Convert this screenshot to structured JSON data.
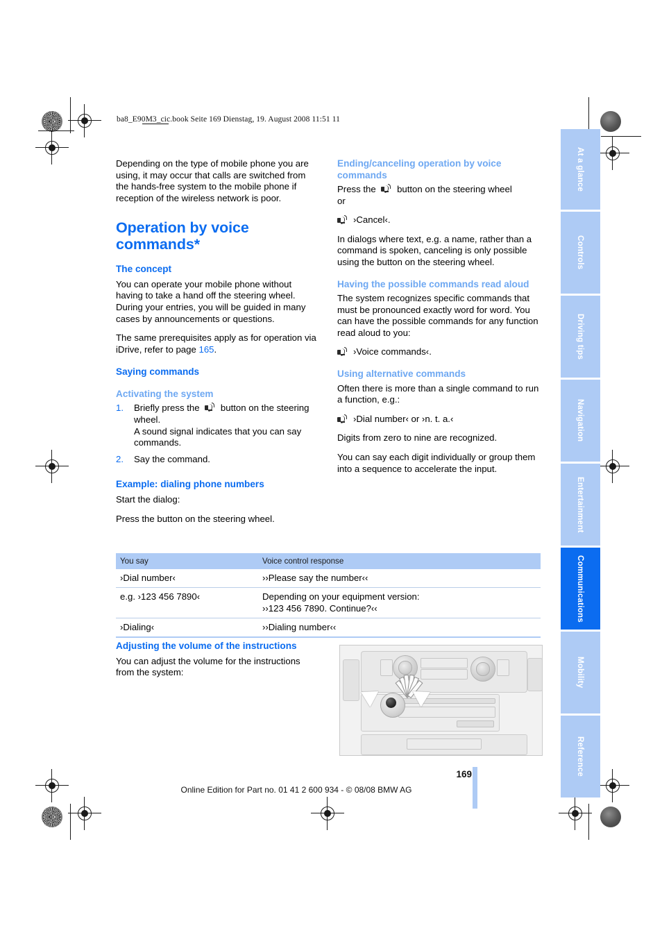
{
  "header": {
    "file_info": "ba8_E90M3_cic.book  Seite 169  Dienstag, 19. August 2008  11:51 11"
  },
  "left_column": {
    "intro_paragraph": "Depending on the type of mobile phone you are using, it may occur that calls are switched from the hands-free system to the mobile phone if reception of the wireless network is poor.",
    "title": "Operation by voice commands*",
    "concept_heading": "The concept",
    "concept_p1": "You can operate your mobile phone without having to take a hand off the steering wheel. During your entries, you will be guided in many cases by announcements or questions.",
    "concept_p2_before": "The same prerequisites apply as for operation via iDrive, refer to page ",
    "concept_p2_ref": "165",
    "concept_p2_after": ".",
    "saying_heading": "Saying commands",
    "activating_heading": "Activating the system",
    "step1_num": "1.",
    "step1_before": "Briefly press the",
    "step1_after": "button on the steering wheel.",
    "step1_note": "A sound signal indicates that you can say commands.",
    "step2_num": "2.",
    "step2_text": "Say the command.",
    "example_heading": "Example: dialing phone numbers",
    "example_p1": "Start the dialog:",
    "example_p2": "Press the button on the steering wheel.",
    "volume_heading": "Adjusting the volume of the instructions",
    "volume_p1": "You can adjust the volume for the instructions from the system:"
  },
  "table": {
    "columns": [
      "You say",
      "Voice control response"
    ],
    "rows": [
      {
        "you_say": "›Dial number‹",
        "response": "››Please say the number‹‹",
        "response2": ""
      },
      {
        "you_say": "e.g. ›123 456 7890‹",
        "response": "Depending on your equipment version:",
        "response2": "››123 456 7890. Continue?‹‹"
      },
      {
        "you_say": "›Dialing‹",
        "response": "››Dialing number‹‹",
        "response2": ""
      }
    ]
  },
  "right_column": {
    "ending_heading": "Ending/canceling operation by voice commands",
    "ending_p1_before": "Press the",
    "ending_p1_after": "button on the steering wheel",
    "ending_or": "or",
    "ending_cmd": "›Cancel‹.",
    "ending_p2": "In dialogs where text, e.g. a name, rather than a command is spoken, canceling is only possible using the button on the steering wheel.",
    "readaloud_heading": "Having the possible commands read aloud",
    "readaloud_p1": "The system recognizes specific commands that must be pronounced exactly word for word. You can have the possible commands for any function read aloud to you:",
    "readaloud_cmd": "›Voice commands‹.",
    "alternative_heading": "Using alternative commands",
    "alternative_p1": "Often there is more than a single command to run a function, e.g.:",
    "alternative_cmd": "›Dial number‹ or ›n. t. a.‹",
    "alternative_p2": "Digits from zero to nine are recognized.",
    "alternative_p3": "You can say each digit individually or group them into a sequence to accelerate the input."
  },
  "side_tabs": {
    "items": [
      {
        "label": "At a glance",
        "active": false
      },
      {
        "label": "Controls",
        "active": false
      },
      {
        "label": "Driving tips",
        "active": false
      },
      {
        "label": "Navigation",
        "active": false
      },
      {
        "label": "Entertainment",
        "active": false
      },
      {
        "label": "Communications",
        "active": true
      },
      {
        "label": "Mobility",
        "active": false
      },
      {
        "label": "Reference",
        "active": false
      }
    ]
  },
  "footer": {
    "page_number": "169",
    "edition_line": "Online Edition for Part no. 01 41 2 600 934 - © 08/08 BMW AG"
  },
  "colors": {
    "heading_blue": "#0b6cf0",
    "subheading_blue": "#6ea8f2",
    "tab_blue": "#aecbf5",
    "tab_active_blue": "#0b6cf0"
  }
}
